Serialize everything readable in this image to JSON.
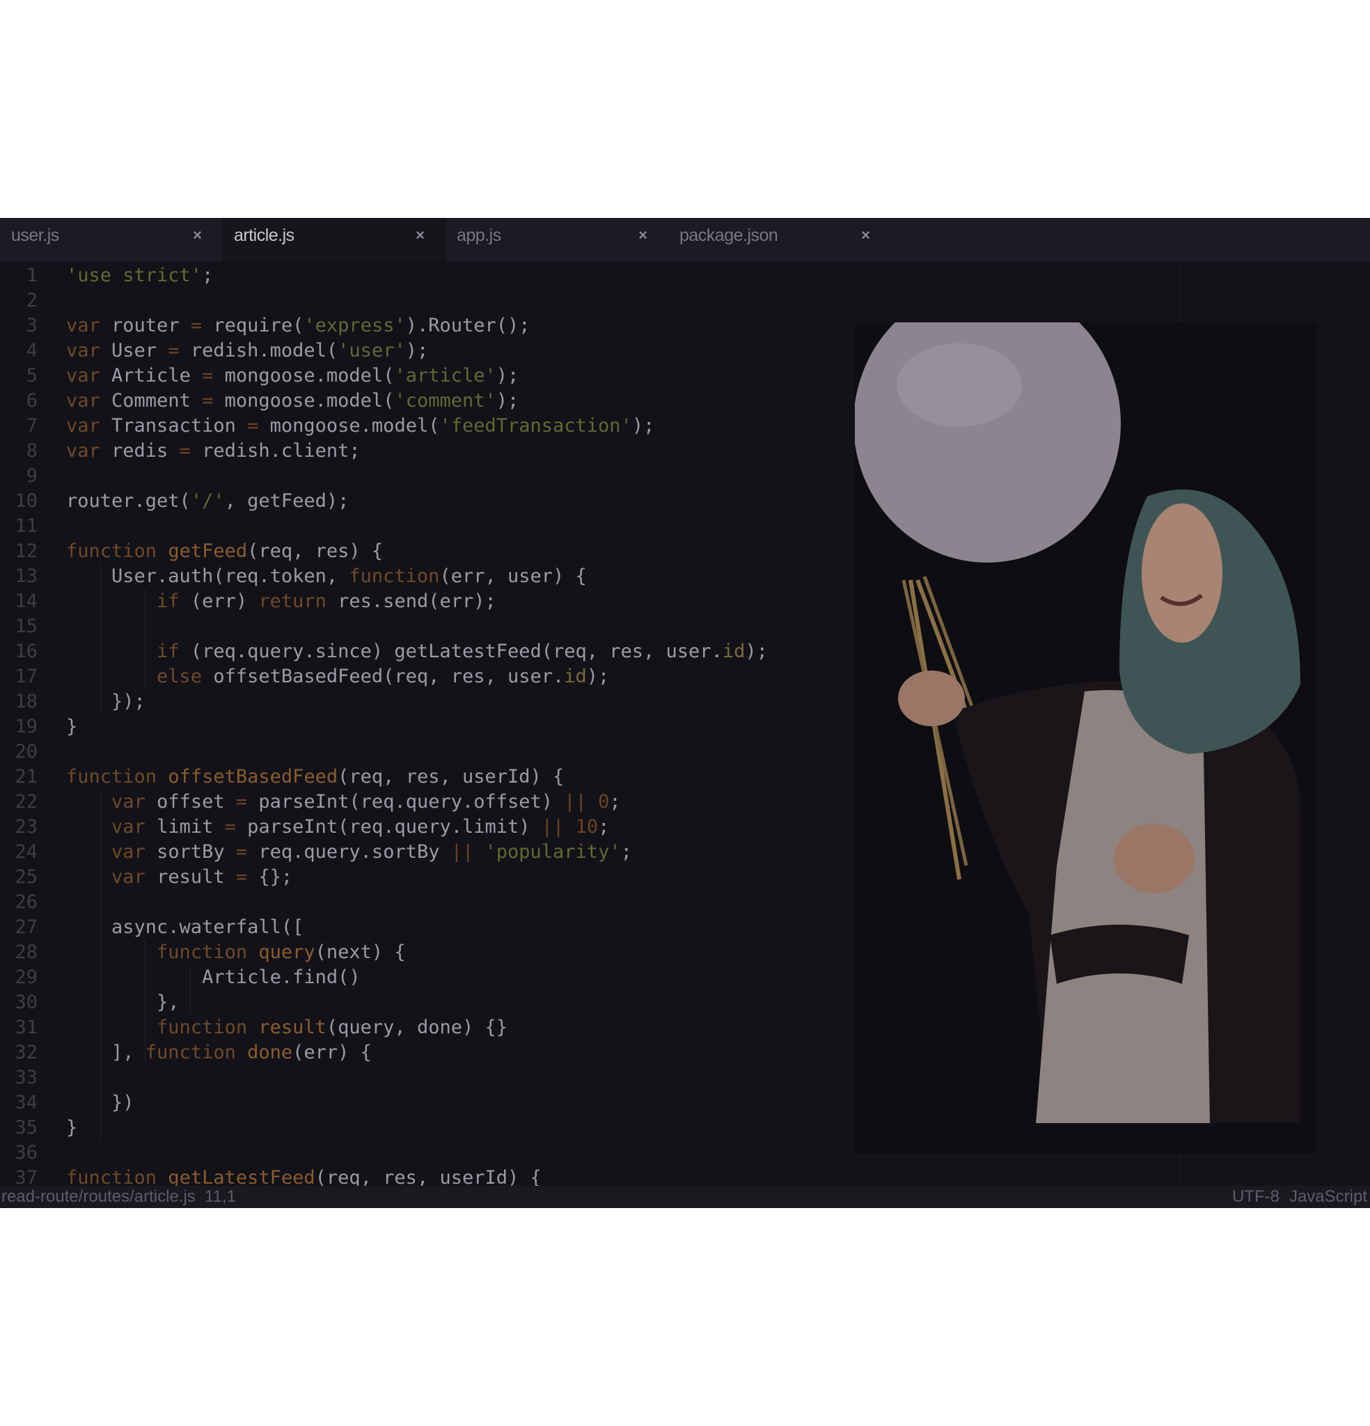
{
  "tabs": [
    {
      "label": "user.js",
      "close": "×"
    },
    {
      "label": "article.js",
      "close": "×"
    },
    {
      "label": "app.js",
      "close": "×"
    },
    {
      "label": "package.json",
      "close": "×"
    }
  ],
  "active_tab": 1,
  "code_lines": [
    [
      [
        "str",
        "'use strict'"
      ],
      [
        "p",
        ";"
      ]
    ],
    [],
    [
      [
        "kw",
        "var"
      ],
      [
        "p",
        " router "
      ],
      [
        "op",
        "="
      ],
      [
        "p",
        " require("
      ],
      [
        "str",
        "'express'"
      ],
      [
        "p",
        ").Router();"
      ]
    ],
    [
      [
        "kw",
        "var"
      ],
      [
        "p",
        " User "
      ],
      [
        "op",
        "="
      ],
      [
        "p",
        " redish.model("
      ],
      [
        "str",
        "'user'"
      ],
      [
        "p",
        ");"
      ]
    ],
    [
      [
        "kw",
        "var"
      ],
      [
        "p",
        " Article "
      ],
      [
        "op",
        "="
      ],
      [
        "p",
        " mongoose.model("
      ],
      [
        "str",
        "'article'"
      ],
      [
        "p",
        ");"
      ]
    ],
    [
      [
        "kw",
        "var"
      ],
      [
        "p",
        " Comment "
      ],
      [
        "op",
        "="
      ],
      [
        "p",
        " mongoose.model("
      ],
      [
        "str",
        "'comment'"
      ],
      [
        "p",
        ");"
      ]
    ],
    [
      [
        "kw",
        "var"
      ],
      [
        "p",
        " Transaction "
      ],
      [
        "op",
        "="
      ],
      [
        "p",
        " mongoose.model("
      ],
      [
        "str",
        "'feedTransaction'"
      ],
      [
        "p",
        ");"
      ]
    ],
    [
      [
        "kw",
        "var"
      ],
      [
        "p",
        " redis "
      ],
      [
        "op",
        "="
      ],
      [
        "p",
        " redish.client;"
      ]
    ],
    [],
    [
      [
        "p",
        "router.get("
      ],
      [
        "str",
        "'/'"
      ],
      [
        "p",
        ", getFeed);"
      ]
    ],
    [],
    [
      [
        "kw",
        "function"
      ],
      [
        "p",
        " "
      ],
      [
        "fn",
        "getFeed"
      ],
      [
        "p",
        "(req, res) {"
      ]
    ],
    [
      [
        "p",
        "    User.auth(req.token, "
      ],
      [
        "kw",
        "function"
      ],
      [
        "p",
        "(err, user) {"
      ]
    ],
    [
      [
        "p",
        "        "
      ],
      [
        "kw",
        "if"
      ],
      [
        "p",
        " (err) "
      ],
      [
        "kw",
        "return"
      ],
      [
        "p",
        " res.send(err);"
      ]
    ],
    [],
    [
      [
        "p",
        "        "
      ],
      [
        "kw",
        "if"
      ],
      [
        "p",
        " (req.query.since) getLatestFeed(req, res, user."
      ],
      [
        "prop",
        "id"
      ],
      [
        "p",
        ");"
      ]
    ],
    [
      [
        "p",
        "        "
      ],
      [
        "kw",
        "else"
      ],
      [
        "p",
        " offsetBasedFeed(req, res, user."
      ],
      [
        "prop",
        "id"
      ],
      [
        "p",
        ");"
      ]
    ],
    [
      [
        "p",
        "    });"
      ]
    ],
    [
      [
        "p",
        "}"
      ]
    ],
    [],
    [
      [
        "kw",
        "function"
      ],
      [
        "p",
        " "
      ],
      [
        "fn",
        "offsetBasedFeed"
      ],
      [
        "p",
        "(req, res, userId) {"
      ]
    ],
    [
      [
        "p",
        "    "
      ],
      [
        "kw",
        "var"
      ],
      [
        "p",
        " offset "
      ],
      [
        "op",
        "="
      ],
      [
        "p",
        " parseInt(req.query.offset) "
      ],
      [
        "op",
        "||"
      ],
      [
        "p",
        " "
      ],
      [
        "num",
        "0"
      ],
      [
        "p",
        ";"
      ]
    ],
    [
      [
        "p",
        "    "
      ],
      [
        "kw",
        "var"
      ],
      [
        "p",
        " limit "
      ],
      [
        "op",
        "="
      ],
      [
        "p",
        " parseInt(req.query.limit) "
      ],
      [
        "op",
        "||"
      ],
      [
        "p",
        " "
      ],
      [
        "num",
        "10"
      ],
      [
        "p",
        ";"
      ]
    ],
    [
      [
        "p",
        "    "
      ],
      [
        "kw",
        "var"
      ],
      [
        "p",
        " sortBy "
      ],
      [
        "op",
        "="
      ],
      [
        "p",
        " req.query.sortBy "
      ],
      [
        "op",
        "||"
      ],
      [
        "p",
        " "
      ],
      [
        "str",
        "'popularity'"
      ],
      [
        "p",
        ";"
      ]
    ],
    [
      [
        "p",
        "    "
      ],
      [
        "kw",
        "var"
      ],
      [
        "p",
        " result "
      ],
      [
        "op",
        "="
      ],
      [
        "p",
        " {};"
      ]
    ],
    [],
    [
      [
        "p",
        "    async.waterfall(["
      ]
    ],
    [
      [
        "p",
        "        "
      ],
      [
        "kw",
        "function"
      ],
      [
        "p",
        " "
      ],
      [
        "fn",
        "query"
      ],
      [
        "p",
        "(next) {"
      ]
    ],
    [
      [
        "p",
        "            Article.find()"
      ]
    ],
    [
      [
        "p",
        "        },"
      ]
    ],
    [
      [
        "p",
        "        "
      ],
      [
        "kw",
        "function"
      ],
      [
        "p",
        " "
      ],
      [
        "fn",
        "result"
      ],
      [
        "p",
        "(query, done) {}"
      ]
    ],
    [
      [
        "p",
        "    ], "
      ],
      [
        "kw",
        "function"
      ],
      [
        "p",
        " "
      ],
      [
        "fn",
        "done"
      ],
      [
        "p",
        "(err) {"
      ]
    ],
    [],
    [
      [
        "p",
        "    })"
      ]
    ],
    [
      [
        "p",
        "}"
      ]
    ],
    [],
    [
      [
        "kw",
        "function"
      ],
      [
        "p",
        " "
      ],
      [
        "fn",
        "getLatestFeed"
      ],
      [
        "p",
        "(req, res, userId) {"
      ]
    ]
  ],
  "status": {
    "path": "read-route/routes/article.js",
    "position": "11,1",
    "encoding": "UTF-8",
    "language": "JavaScript"
  },
  "photo_description_icon": "photo-woman-with-balloon"
}
